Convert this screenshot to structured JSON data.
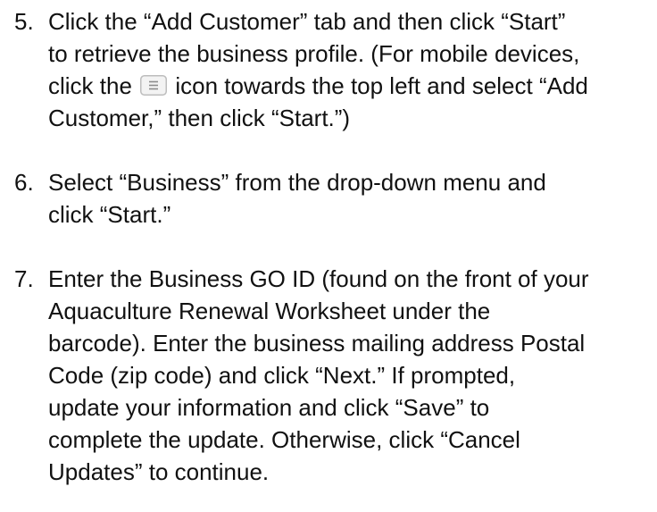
{
  "steps": [
    {
      "number": "5.",
      "text_before_icon": "Click the “Add Customer” tab and then click “Start” to retrieve the business profile. (For mobile devices, click the",
      "icon": "menu-icon",
      "text_after_icon": "icon towards the top left and select “Add Customer,” then click “Start.”)"
    },
    {
      "number": "6.",
      "text": "Select “Business” from the drop-down menu and click “Start.”"
    },
    {
      "number": "7.",
      "text": "Enter the Business GO ID (found on the front of your Aquaculture Renewal Worksheet under the barcode). Enter the business mailing address Postal Code (zip code) and click “Next.” If prompted, update your information and click “Save” to complete the update. Otherwise, click “Cancel Updates” to continue."
    }
  ]
}
